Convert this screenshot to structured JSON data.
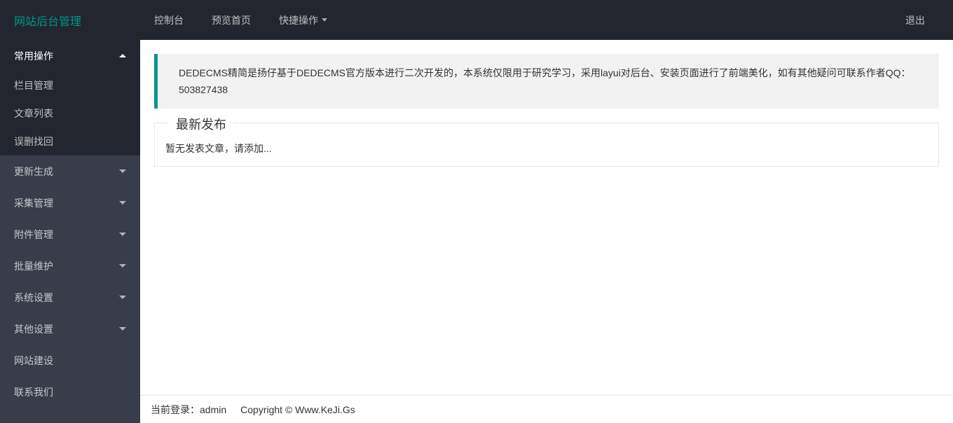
{
  "header": {
    "logo": "网站后台管理",
    "nav": [
      {
        "label": "控制台",
        "hasDropdown": false
      },
      {
        "label": "预览首页",
        "hasDropdown": false
      },
      {
        "label": "快捷操作",
        "hasDropdown": true
      }
    ],
    "logout": "退出"
  },
  "sidebar": {
    "items": [
      {
        "label": "常用操作",
        "type": "group",
        "expanded": true,
        "subitems": [
          {
            "label": "栏目管理"
          },
          {
            "label": "文章列表"
          },
          {
            "label": "误删找回"
          }
        ]
      },
      {
        "label": "更新生成",
        "type": "group",
        "expanded": false
      },
      {
        "label": "采集管理",
        "type": "group",
        "expanded": false
      },
      {
        "label": "附件管理",
        "type": "group",
        "expanded": false
      },
      {
        "label": "批量维护",
        "type": "group",
        "expanded": false
      },
      {
        "label": "系统设置",
        "type": "group",
        "expanded": false
      },
      {
        "label": "其他设置",
        "type": "group",
        "expanded": false
      },
      {
        "label": "网站建设",
        "type": "link"
      },
      {
        "label": "联系我们",
        "type": "link"
      }
    ]
  },
  "main": {
    "quote": "DEDECMS精简是扬仔基于DEDECMS官方版本进行二次开发的，本系统仅限用于研究学习，采用layui对后台、安装页面进行了前端美化，如有其他疑问可联系作者QQ：503827438",
    "fieldset_title": "最新发布",
    "fieldset_content": "暂无发表文章，请添加..."
  },
  "footer": {
    "login_label": "当前登录：",
    "username": "admin",
    "copyright": "Copyright © Www.KeJi.Gs"
  }
}
